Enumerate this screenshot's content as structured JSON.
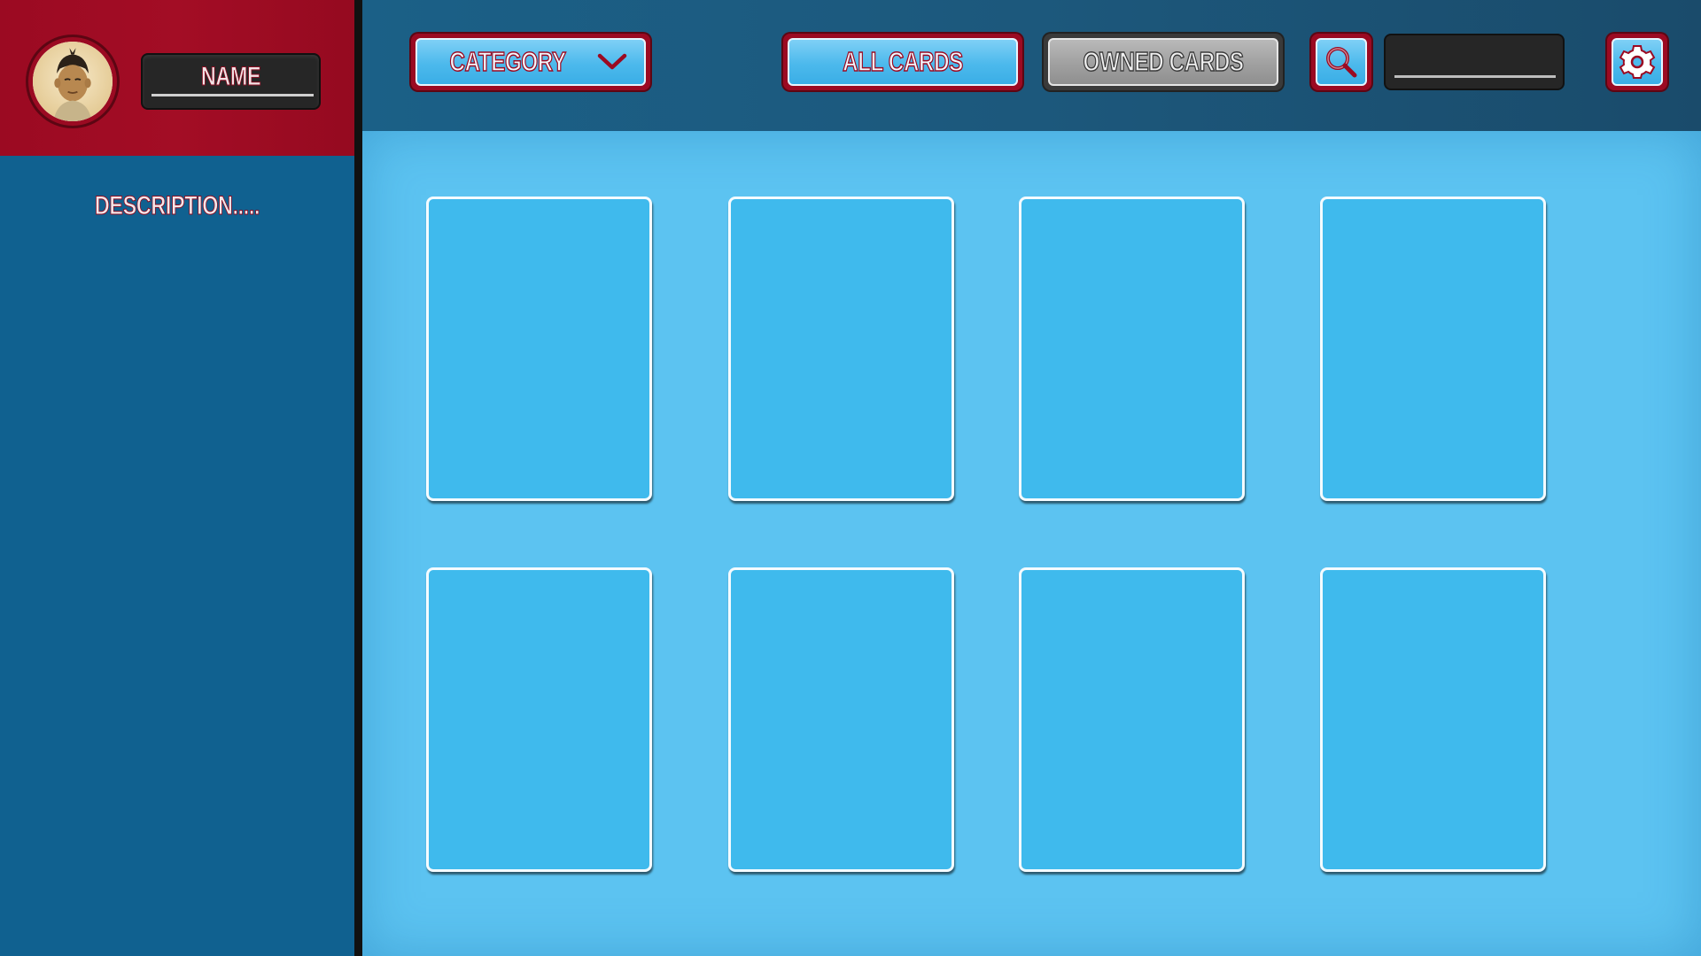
{
  "profile": {
    "name": "NAME",
    "description": "DESCRIPTION.....",
    "avatar_icon": "avatar-portrait"
  },
  "toolbar": {
    "category_label": "CATEGORY",
    "category_icon": "chevron-down-icon",
    "all_cards_label": "ALL CARDS",
    "owned_cards_label": "OWNED CARDS",
    "search_icon": "search-icon",
    "search_value": "",
    "settings_icon": "gear-icon",
    "active_tab": "ALL CARDS"
  },
  "colors": {
    "accent_red": "#9b0a22",
    "button_blue": "#4cb9ec",
    "button_gray": "#a0a0a0",
    "sidebar_blue": "#106190",
    "panel_blue": "#5cc3f1",
    "card_blue": "#3fbaed"
  },
  "cards": [
    {
      "id": 1
    },
    {
      "id": 2
    },
    {
      "id": 3
    },
    {
      "id": 4
    },
    {
      "id": 5
    },
    {
      "id": 6
    },
    {
      "id": 7
    },
    {
      "id": 8
    }
  ]
}
